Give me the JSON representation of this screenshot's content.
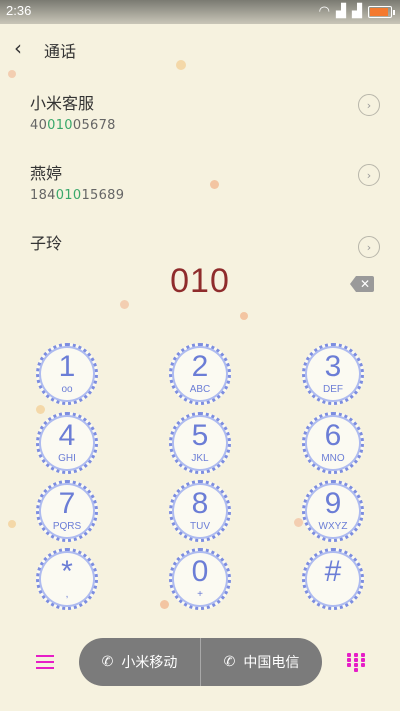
{
  "status": {
    "time": "2:36"
  },
  "header": {
    "title": "通话"
  },
  "contacts": [
    {
      "name": "小米客服",
      "num_pre": "40",
      "num_hl": "010",
      "num_post": "05678"
    },
    {
      "name": "燕婷",
      "num_pre": "184",
      "num_hl": "010",
      "num_post": "15689"
    },
    {
      "name": "子玲",
      "num_pre": "",
      "num_hl": "",
      "num_post": ""
    }
  ],
  "dialer": {
    "value": "010"
  },
  "keys": [
    {
      "digit": "1",
      "letters": "oo"
    },
    {
      "digit": "2",
      "letters": "ABC"
    },
    {
      "digit": "3",
      "letters": "DEF"
    },
    {
      "digit": "4",
      "letters": "GHI"
    },
    {
      "digit": "5",
      "letters": "JKL"
    },
    {
      "digit": "6",
      "letters": "MNO"
    },
    {
      "digit": "7",
      "letters": "PQRS"
    },
    {
      "digit": "8",
      "letters": "TUV"
    },
    {
      "digit": "9",
      "letters": "WXYZ"
    },
    {
      "digit": "*",
      "letters": ","
    },
    {
      "digit": "0",
      "letters": "+"
    },
    {
      "digit": "#",
      "letters": ""
    }
  ],
  "call_buttons": {
    "sim1": {
      "label": "小米移动",
      "slot": "1"
    },
    "sim2": {
      "label": "中国电信",
      "slot": "2"
    }
  },
  "colors": {
    "accent": "#e61ec7",
    "dialed": "#8f2c2c",
    "key": "#6b7dd6",
    "match": "#3aa86b"
  }
}
